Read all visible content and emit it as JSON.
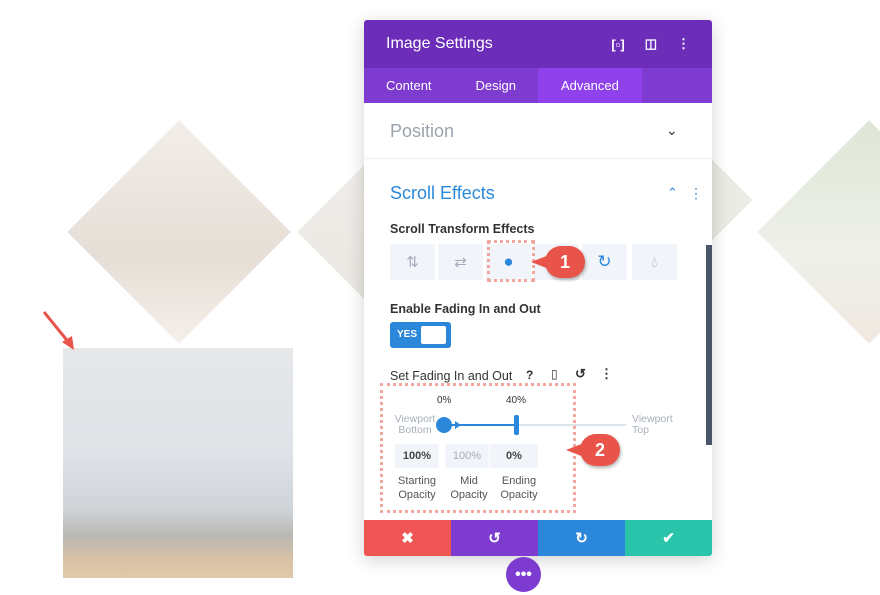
{
  "panel": {
    "title": "Image Settings",
    "header_icons": [
      "fullscreen-icon",
      "split-view-icon",
      "more-vertical-icon"
    ],
    "tabs": [
      {
        "label": "Content"
      },
      {
        "label": "Design"
      },
      {
        "label": "Advanced"
      }
    ],
    "active_tab": "Advanced"
  },
  "position": {
    "title": "Position"
  },
  "scroll": {
    "title": "Scroll Effects",
    "transform_label": "Scroll Transform Effects",
    "effect_icons": [
      "vertical-motion-icon",
      "horizontal-motion-icon",
      "fading-icon",
      "scale-icon",
      "rotate-icon",
      "blur-icon"
    ],
    "enable_label": "Enable Fading In and Out",
    "toggle": "YES",
    "set_label": "Set Fading In and Out",
    "help": "?",
    "start_pct": "0%",
    "end_pct": "40%",
    "vp_bottom": "Viewport Bottom",
    "vp_top": "Viewport Top",
    "start_val": "100%",
    "mid_val": "100%",
    "end_val": "0%",
    "start_cap": "Starting Opacity",
    "mid_cap": "Mid Opacity",
    "end_cap": "Ending Opacity"
  },
  "badges": {
    "one": "1",
    "two": "2"
  },
  "footer": {
    "icons": [
      "cancel-icon",
      "undo-icon",
      "redo-icon",
      "save-icon"
    ]
  },
  "colors": {
    "header": "#6c2eb9",
    "accent": "#2b87da",
    "cancel": "#ef5555",
    "undo": "#7d3bcf",
    "redo": "#2b87da",
    "save": "#29c4a9"
  }
}
